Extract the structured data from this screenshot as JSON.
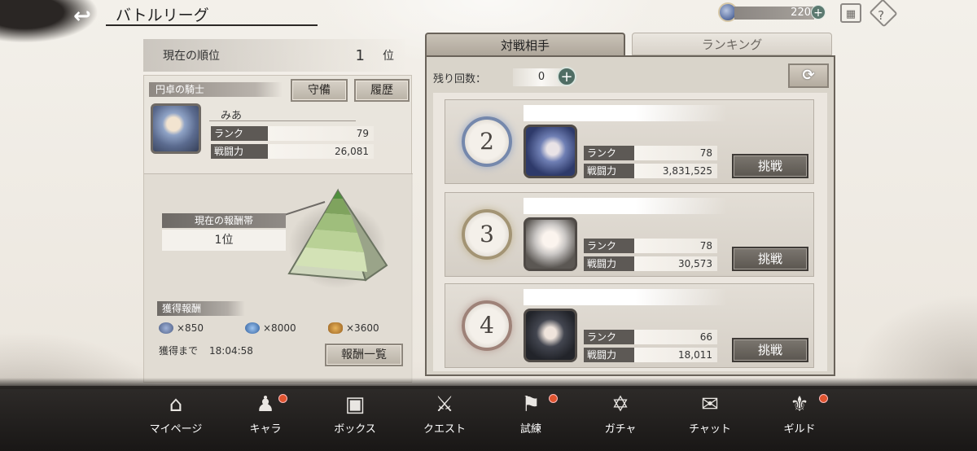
{
  "header": {
    "back_icon": "back-arrow-icon",
    "title": "バトルリーグ",
    "stamina_value": "220",
    "stamina_plus": "+",
    "menu_icon": "grid-menu-icon",
    "help_icon": "help-icon"
  },
  "left": {
    "current_rank_label": "現在の順位",
    "current_rank_value": "1",
    "current_rank_unit": "位",
    "knight_tag": "円卓の騎士",
    "defense_button": "守備",
    "history_button": "履歴",
    "player": {
      "name": "みあ",
      "rank_label": "ランク",
      "rank_value": "79",
      "power_label": "戦闘力",
      "power_value": "26,081"
    },
    "reward_band_label": "現在の報酬帯",
    "reward_band_value": "1位",
    "earned_label": "獲得報酬",
    "rewards": [
      {
        "icon": "stamina-crystal-icon",
        "amount": "×850"
      },
      {
        "icon": "blue-gem-icon",
        "amount": "×8000"
      },
      {
        "icon": "gold-ore-icon",
        "amount": "×3600"
      }
    ],
    "until_label": "獲得まで",
    "until_time": "18:04:58",
    "rewards_list_button": "報酬一覧"
  },
  "right": {
    "tabs": [
      {
        "label": "対戦相手",
        "active": true
      },
      {
        "label": "ランキング",
        "active": false
      }
    ],
    "remaining_label": "残り回数：",
    "remaining_value": "0",
    "remaining_plus": "+",
    "refresh_icon": "refresh-icon",
    "opponents": [
      {
        "rank": "2",
        "rank_label": "ランク",
        "rank_value": "78",
        "power_label": "戦闘力",
        "power_value": "3,831,525",
        "challenge": "挑戦"
      },
      {
        "rank": "3",
        "rank_label": "ランク",
        "rank_value": "78",
        "power_label": "戦闘力",
        "power_value": "30,573",
        "challenge": "挑戦"
      },
      {
        "rank": "4",
        "rank_label": "ランク",
        "rank_value": "66",
        "power_label": "戦闘力",
        "power_value": "18,011",
        "challenge": "挑戦"
      }
    ]
  },
  "nav": [
    {
      "label": "マイページ",
      "icon": "home-icon",
      "badge": false
    },
    {
      "label": "キャラ",
      "icon": "characters-icon",
      "badge": true
    },
    {
      "label": "ボックス",
      "icon": "chest-icon",
      "badge": false
    },
    {
      "label": "クエスト",
      "icon": "crossed-swords-icon",
      "badge": false
    },
    {
      "label": "試練",
      "icon": "flag-icon",
      "badge": true
    },
    {
      "label": "ガチャ",
      "icon": "hexagram-icon",
      "badge": false
    },
    {
      "label": "チャット",
      "icon": "chat-icon",
      "badge": false
    },
    {
      "label": "ギルド",
      "icon": "guild-emblem-icon",
      "badge": true
    }
  ]
}
